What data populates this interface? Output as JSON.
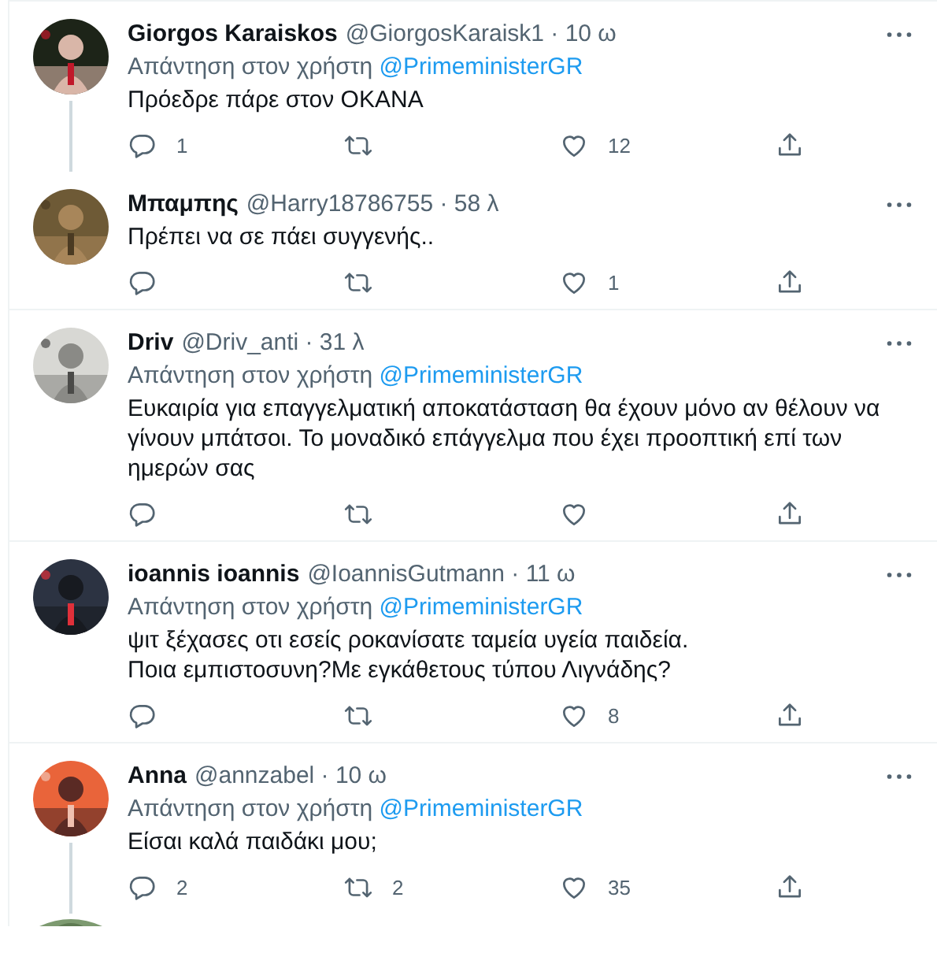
{
  "tweets": [
    {
      "name": "Giorgos Karaiskos",
      "meta": "@GiorgosKaraisk1 · 10 ω",
      "reply_to": {
        "prefix": "Απάντηση στον χρήστη",
        "mention": "@PrimeministerGR"
      },
      "text": "Πρόεδρε πάρε στον ΟΚΑΝΑ",
      "replies": "1",
      "likes": "12",
      "thread_line": true
    },
    {
      "name": "Μπαμπης",
      "meta": "@Harry18786755 · 58 λ",
      "text": "Πρέπει να σε πάει συγγενής..",
      "likes": "1",
      "thread_line": false
    },
    {
      "name": "Driv",
      "meta": "@Driv_anti · 31 λ",
      "reply_to": {
        "prefix": "Απάντηση στον χρήστη",
        "mention": "@PrimeministerGR"
      },
      "text": "Ευκαιρία για επαγγελματική αποκατάσταση θα έχουν μόνο αν θέλουν να γίνουν μπάτσοι. Το μοναδικό επάγγελμα που έχει προοπτική επί των ημερών σας",
      "thread_line": false
    },
    {
      "name": "ioannis ioannis",
      "meta": "@IoannisGutmann · 11 ω",
      "reply_to": {
        "prefix": "Απάντηση στον χρήστη",
        "mention": "@PrimeministerGR"
      },
      "text": "ψιτ ξέχασες οτι εσείς ροκανίσατε ταμεία υγεία παιδεία.\nΠοια εμπιστοσυνη?Με εγκάθετους τύπου Λιγνάδης?",
      "likes": "8",
      "thread_line": false
    },
    {
      "name": "Anna",
      "meta": "@annzabel · 10 ω",
      "reply_to": {
        "prefix": "Απάντηση στον χρήστη",
        "mention": "@PrimeministerGR"
      },
      "text": "Είσαι καλά παιδάκι μου;",
      "replies": "2",
      "retweets": "2",
      "likes": "35",
      "thread_line": true
    }
  ]
}
